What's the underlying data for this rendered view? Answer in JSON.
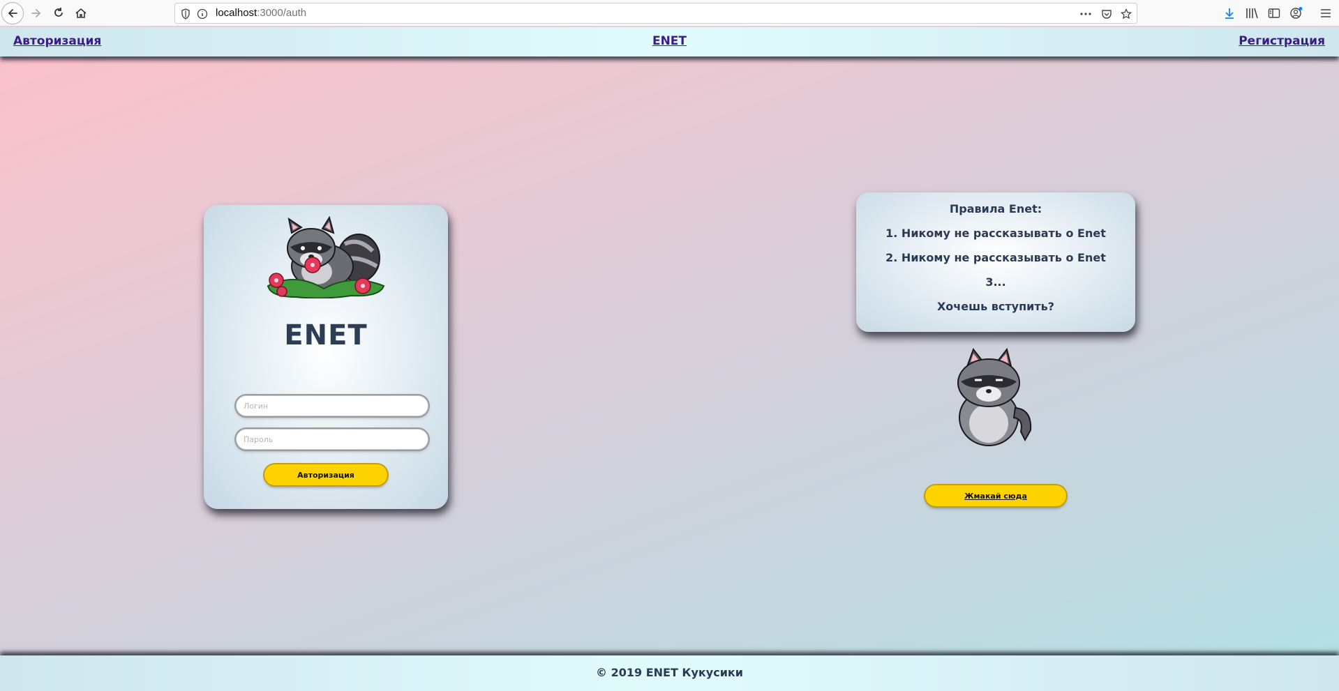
{
  "browser": {
    "url_host": "localhost",
    "url_path": ":3000/auth",
    "icons": [
      "back-arrow-icon",
      "forward-arrow-icon",
      "reload-icon",
      "home-icon",
      "shield-icon",
      "info-icon",
      "more-icon",
      "pocket-icon",
      "star-icon",
      "download-icon",
      "library-icon",
      "sidebar-icon",
      "account-icon",
      "menu-icon"
    ]
  },
  "header": {
    "left_link": "Авторизация",
    "brand": "ENET",
    "right_link": "Регистрация"
  },
  "auth": {
    "title": "ENET",
    "login_placeholder": "Логин",
    "password_placeholder": "Пароль",
    "submit_label": "Авторизация"
  },
  "rules": {
    "heading": "Правила Enet:",
    "lines": [
      "1. Никому не рассказывать о Enet",
      "2. Никому не рассказывать о Enet",
      "3..."
    ],
    "question": "Хочешь вступить?",
    "cta_label": "Жмакай сюда"
  },
  "footer": {
    "text": "© 2019 ENET Кукусики"
  },
  "colors": {
    "accent_yellow": "#ffd300",
    "link_purple": "#3a1c86",
    "text_navy": "#2a3a55"
  }
}
